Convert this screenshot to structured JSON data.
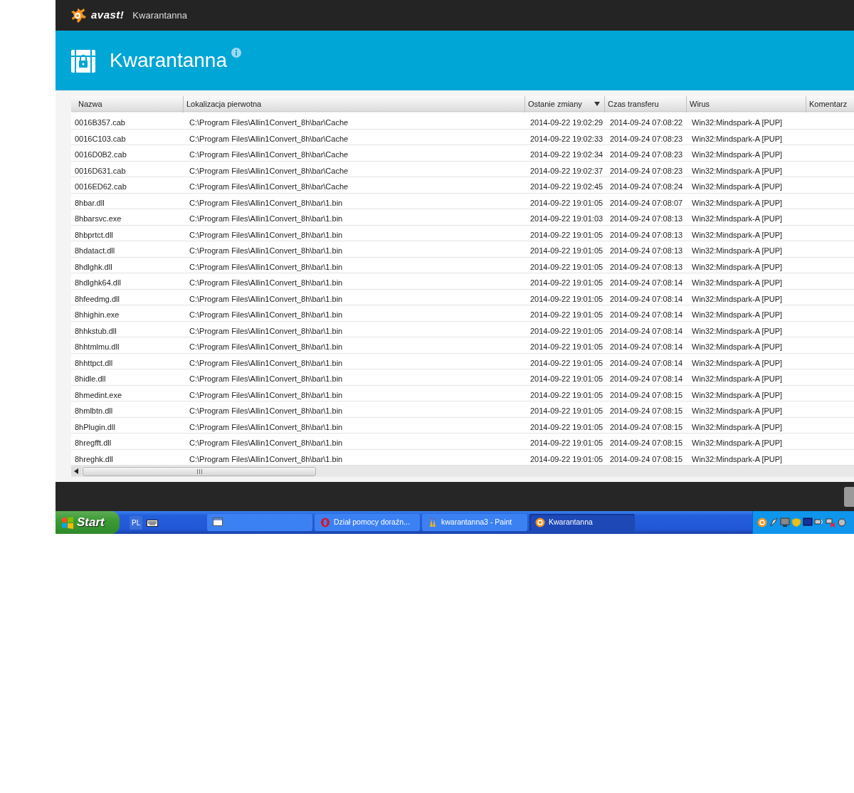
{
  "window": {
    "logo_text": "avast!",
    "title": "Kwarantanna"
  },
  "header": {
    "title": "Kwarantanna"
  },
  "table": {
    "columns": [
      {
        "label": "Nazwa",
        "sorted": false
      },
      {
        "label": "Lokalizacja pierwotna",
        "sorted": false
      },
      {
        "label": "Ostanie zmiany",
        "sorted": true
      },
      {
        "label": "Czas transferu",
        "sorted": false
      },
      {
        "label": "Wirus",
        "sorted": false
      },
      {
        "label": "Komentarz",
        "sorted": false
      }
    ],
    "rows": [
      [
        "0016B357.cab",
        "C:\\Program Files\\Allin1Convert_8h\\bar\\Cache",
        "2014-09-22 19:02:29",
        "2014-09-24 07:08:22",
        "Win32:Mindspark-A [PUP]"
      ],
      [
        "0016C103.cab",
        "C:\\Program Files\\Allin1Convert_8h\\bar\\Cache",
        "2014-09-22 19:02:33",
        "2014-09-24 07:08:23",
        "Win32:Mindspark-A [PUP]"
      ],
      [
        "0016D0B2.cab",
        "C:\\Program Files\\Allin1Convert_8h\\bar\\Cache",
        "2014-09-22 19:02:34",
        "2014-09-24 07:08:23",
        "Win32:Mindspark-A [PUP]"
      ],
      [
        "0016D631.cab",
        "C:\\Program Files\\Allin1Convert_8h\\bar\\Cache",
        "2014-09-22 19:02:37",
        "2014-09-24 07:08:23",
        "Win32:Mindspark-A [PUP]"
      ],
      [
        "0016ED62.cab",
        "C:\\Program Files\\Allin1Convert_8h\\bar\\Cache",
        "2014-09-22 19:02:45",
        "2014-09-24 07:08:24",
        "Win32:Mindspark-A [PUP]"
      ],
      [
        "8hbar.dll",
        "C:\\Program Files\\Allin1Convert_8h\\bar\\1.bin",
        "2014-09-22 19:01:05",
        "2014-09-24 07:08:07",
        "Win32:Mindspark-A [PUP]"
      ],
      [
        "8hbarsvc.exe",
        "C:\\Program Files\\Allin1Convert_8h\\bar\\1.bin",
        "2014-09-22 19:01:03",
        "2014-09-24 07:08:13",
        "Win32:Mindspark-A [PUP]"
      ],
      [
        "8hbprtct.dll",
        "C:\\Program Files\\Allin1Convert_8h\\bar\\1.bin",
        "2014-09-22 19:01:05",
        "2014-09-24 07:08:13",
        "Win32:Mindspark-A [PUP]"
      ],
      [
        "8hdatact.dll",
        "C:\\Program Files\\Allin1Convert_8h\\bar\\1.bin",
        "2014-09-22 19:01:05",
        "2014-09-24 07:08:13",
        "Win32:Mindspark-A [PUP]"
      ],
      [
        "8hdlghk.dll",
        "C:\\Program Files\\Allin1Convert_8h\\bar\\1.bin",
        "2014-09-22 19:01:05",
        "2014-09-24 07:08:13",
        "Win32:Mindspark-A [PUP]"
      ],
      [
        "8hdlghk64.dll",
        "C:\\Program Files\\Allin1Convert_8h\\bar\\1.bin",
        "2014-09-22 19:01:05",
        "2014-09-24 07:08:14",
        "Win32:Mindspark-A [PUP]"
      ],
      [
        "8hfeedmg.dll",
        "C:\\Program Files\\Allin1Convert_8h\\bar\\1.bin",
        "2014-09-22 19:01:05",
        "2014-09-24 07:08:14",
        "Win32:Mindspark-A [PUP]"
      ],
      [
        "8hhighin.exe",
        "C:\\Program Files\\Allin1Convert_8h\\bar\\1.bin",
        "2014-09-22 19:01:05",
        "2014-09-24 07:08:14",
        "Win32:Mindspark-A [PUP]"
      ],
      [
        "8hhkstub.dll",
        "C:\\Program Files\\Allin1Convert_8h\\bar\\1.bin",
        "2014-09-22 19:01:05",
        "2014-09-24 07:08:14",
        "Win32:Mindspark-A [PUP]"
      ],
      [
        "8hhtmlmu.dll",
        "C:\\Program Files\\Allin1Convert_8h\\bar\\1.bin",
        "2014-09-22 19:01:05",
        "2014-09-24 07:08:14",
        "Win32:Mindspark-A [PUP]"
      ],
      [
        "8hhttpct.dll",
        "C:\\Program Files\\Allin1Convert_8h\\bar\\1.bin",
        "2014-09-22 19:01:05",
        "2014-09-24 07:08:14",
        "Win32:Mindspark-A [PUP]"
      ],
      [
        "8hidle.dll",
        "C:\\Program Files\\Allin1Convert_8h\\bar\\1.bin",
        "2014-09-22 19:01:05",
        "2014-09-24 07:08:14",
        "Win32:Mindspark-A [PUP]"
      ],
      [
        "8hmedint.exe",
        "C:\\Program Files\\Allin1Convert_8h\\bar\\1.bin",
        "2014-09-22 19:01:05",
        "2014-09-24 07:08:15",
        "Win32:Mindspark-A [PUP]"
      ],
      [
        "8hmlbtn.dll",
        "C:\\Program Files\\Allin1Convert_8h\\bar\\1.bin",
        "2014-09-22 19:01:05",
        "2014-09-24 07:08:15",
        "Win32:Mindspark-A [PUP]"
      ],
      [
        "8hPlugin.dll",
        "C:\\Program Files\\Allin1Convert_8h\\bar\\1.bin",
        "2014-09-22 19:01:05",
        "2014-09-24 07:08:15",
        "Win32:Mindspark-A [PUP]"
      ],
      [
        "8hregfft.dll",
        "C:\\Program Files\\Allin1Convert_8h\\bar\\1.bin",
        "2014-09-22 19:01:05",
        "2014-09-24 07:08:15",
        "Win32:Mindspark-A [PUP]"
      ],
      [
        "8hreghk.dll",
        "C:\\Program Files\\Allin1Convert_8h\\bar\\1.bin",
        "2014-09-22 19:01:05",
        "2014-09-24 07:08:15",
        "Win32:Mindspark-A [PUP]"
      ]
    ]
  },
  "taskbar": {
    "start": "Start",
    "language": "PL",
    "tasks": [
      {
        "kind": "window",
        "selected": false
      },
      {
        "kind": "browser",
        "label": "Dział pomocy doraźn...",
        "selected": false
      },
      {
        "kind": "paint",
        "label": "kwarantanna3 - Paint",
        "selected": false
      },
      {
        "kind": "antivirus",
        "label": "Kwarantanna",
        "selected": true
      }
    ]
  }
}
